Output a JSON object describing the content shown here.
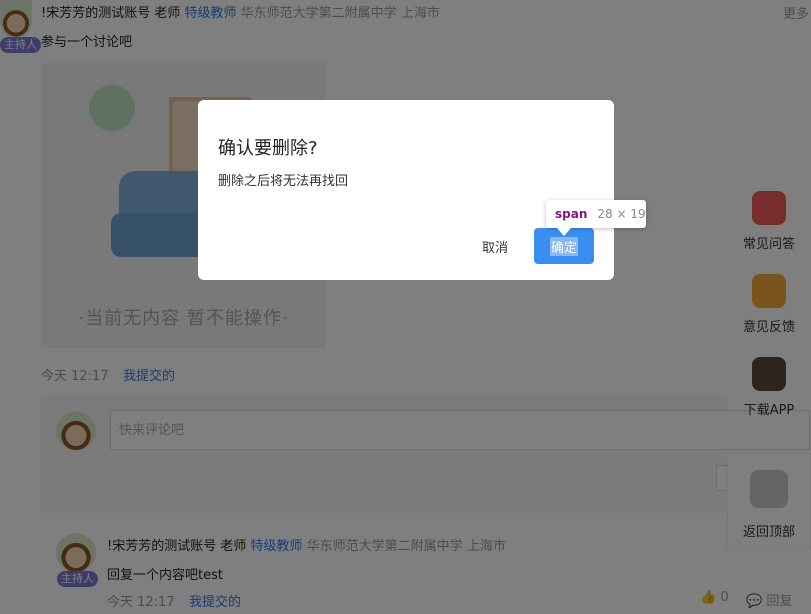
{
  "post": {
    "author": "!宋芳芳的测试账号 老师",
    "title_rank": "特级教师",
    "school": "华东师范大学第二附属中学",
    "city": "上海市",
    "more": "更多",
    "host_badge": "主持人",
    "content": "参与一个讨论吧",
    "empty_placeholder": "·当前无内容 暂不能操作·",
    "time": "今天 12:17",
    "submitted_link": "我提交的"
  },
  "comment_box": {
    "placeholder": "快来评论吧"
  },
  "reply": {
    "author": "!宋芳芳的测试账号 老师",
    "title_rank": "特级教师",
    "school": "华东师范大学第二附属中学",
    "city": "上海市",
    "host_badge": "主持人",
    "content": "回复一个内容吧test",
    "time": "今天 12:17",
    "submitted_link": "我提交的",
    "like_count": "0",
    "reply_label": "回复"
  },
  "side_tools": {
    "faq": "常见问答",
    "feedback": "意见反馈",
    "download": "下载APP",
    "back_top": "返回顶部"
  },
  "dialog": {
    "title": "确认要删除?",
    "message": "删除之后将无法再找回",
    "cancel": "取消",
    "confirm": "确定"
  },
  "devtools_tooltip": {
    "tag": "span",
    "dims": "28 × 19"
  },
  "colors": {
    "accent_blue": "#3a8ef0",
    "link_blue": "#2d7be5",
    "host_badge": "#7b7bd6"
  }
}
